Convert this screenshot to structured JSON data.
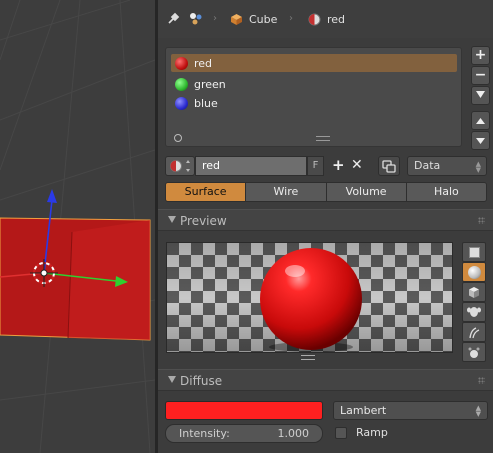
{
  "header": {
    "object_name": "Cube",
    "material_name": "red"
  },
  "material_slots": [
    {
      "label": "red",
      "color": "#d21a1a",
      "active": true
    },
    {
      "label": "green",
      "color": "#2fb82f",
      "active": false
    },
    {
      "label": "blue",
      "color": "#2a2ad0",
      "active": false
    }
  ],
  "material": {
    "name": "red",
    "fake_user_label": "F",
    "link_value": "Data"
  },
  "tabs": [
    {
      "label": "Surface",
      "active": true
    },
    {
      "label": "Wire",
      "active": false
    },
    {
      "label": "Volume",
      "active": false
    },
    {
      "label": "Halo",
      "active": false
    }
  ],
  "preview": {
    "title": "Preview"
  },
  "diffuse": {
    "title": "Diffuse",
    "color": "#ff2020",
    "shader": "Lambert",
    "intensity_label": "Intensity:",
    "intensity_value": "1.000",
    "ramp_label": "Ramp"
  },
  "colors": {
    "accent": "#d08a3e",
    "active_slot": "#82613e"
  }
}
